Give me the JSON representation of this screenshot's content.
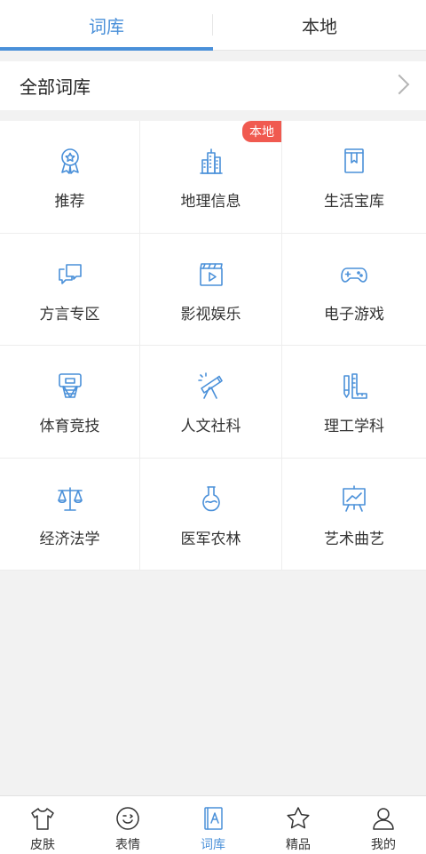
{
  "tabs": [
    {
      "label": "词库",
      "active": true
    },
    {
      "label": "本地",
      "active": false
    }
  ],
  "all_dict": {
    "label": "全部词库"
  },
  "categories": [
    {
      "label": "推荐",
      "icon": "award-ribbon-icon"
    },
    {
      "label": "地理信息",
      "icon": "city-buildings-icon",
      "badge": "本地"
    },
    {
      "label": "生活宝库",
      "icon": "bookmark-book-icon"
    },
    {
      "label": "方言专区",
      "icon": "chat-bubbles-icon"
    },
    {
      "label": "影视娱乐",
      "icon": "clapperboard-icon"
    },
    {
      "label": "电子游戏",
      "icon": "gamepad-icon"
    },
    {
      "label": "体育竞技",
      "icon": "basketball-hoop-icon"
    },
    {
      "label": "人文社科",
      "icon": "telescope-icon"
    },
    {
      "label": "理工学科",
      "icon": "pencil-ruler-icon"
    },
    {
      "label": "经济法学",
      "icon": "scales-icon"
    },
    {
      "label": "医军农林",
      "icon": "flask-icon"
    },
    {
      "label": "艺术曲艺",
      "icon": "easel-icon"
    }
  ],
  "bottom_nav": [
    {
      "label": "皮肤",
      "icon": "tshirt-icon",
      "active": false
    },
    {
      "label": "表情",
      "icon": "smiley-icon",
      "active": false
    },
    {
      "label": "词库",
      "icon": "dictionary-a-icon",
      "active": true
    },
    {
      "label": "精品",
      "icon": "star-icon",
      "active": false
    },
    {
      "label": "我的",
      "icon": "user-icon",
      "active": false
    }
  ],
  "colors": {
    "accent": "#4a90d9",
    "badge": "#f05a50",
    "background": "#f2f2f2"
  }
}
